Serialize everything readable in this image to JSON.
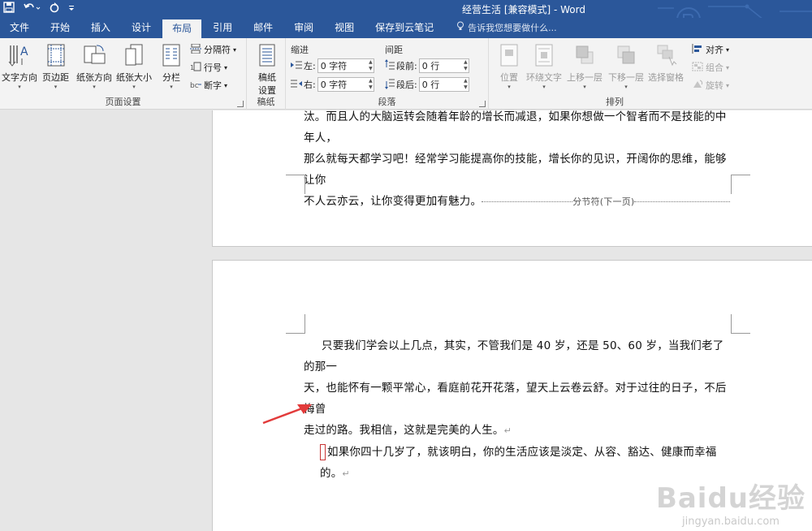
{
  "window": {
    "title": "经营生活 [兼容模式] - Word",
    "qat": [
      "save-icon",
      "undo-icon",
      "redo-icon",
      "customize-icon"
    ]
  },
  "tabs": [
    "文件",
    "开始",
    "插入",
    "设计",
    "布局",
    "引用",
    "邮件",
    "审阅",
    "视图",
    "保存到云笔记"
  ],
  "active_tab": "布局",
  "tell_me": "告诉我您想要做什么...",
  "ribbon": {
    "page_setup": {
      "label": "页面设置",
      "text_direction": "文字方向",
      "margins": "页边距",
      "orientation": "纸张方向",
      "size": "纸张大小",
      "columns": "分栏",
      "breaks": "分隔符",
      "line_numbers": "行号",
      "hyphenation": "断字"
    },
    "manuscript": {
      "label": "稿纸",
      "settings_line1": "稿纸",
      "settings_line2": "设置"
    },
    "paragraph": {
      "label": "段落",
      "indent": "缩进",
      "spacing": "间距",
      "left": "左:",
      "right": "右:",
      "before": "段前:",
      "after": "段后:",
      "left_value": "0 字符",
      "right_value": "0 字符",
      "before_value": "0 行",
      "after_value": "0 行"
    },
    "arrange": {
      "label": "排列",
      "position": "位置",
      "wrap_text": "环绕文字",
      "bring_forward": "上移一层",
      "send_backward": "下移一层",
      "selection_pane": "选择窗格",
      "align": "对齐",
      "group": "组合",
      "rotate": "旋转"
    }
  },
  "document": {
    "page1_lines": [
      "汰。而且人的大脑运转会随着年龄的增长而减退，如果你想做一个智者而不是技能的中年人，",
      "那么就每天都学习吧！经常学习能提高你的技能，增长你的见识，开阔你的思维，能够让你",
      "不人云亦云，让你变得更加有魅力。"
    ],
    "section_break": "分节符(下一页)",
    "page2_lines": [
      "只要我们学会以上几点，其实，不管我们是 40 岁，还是 50、60 岁，当我们老了的那一",
      "天，也能怀有一颗平常心，看庭前花开花落，望天上云卷云舒。对于过往的日子，不后悔曾",
      "走过的路。我相信，这就是完美的人生。"
    ],
    "page2_last": "如果你四十几岁了，就该明白，你的生活应该是淡定、从容、豁达、健康而幸福的。",
    "para_mark": "↵"
  },
  "watermark": {
    "main": "Baidu经验",
    "sub": "jingyan.baidu.com"
  }
}
